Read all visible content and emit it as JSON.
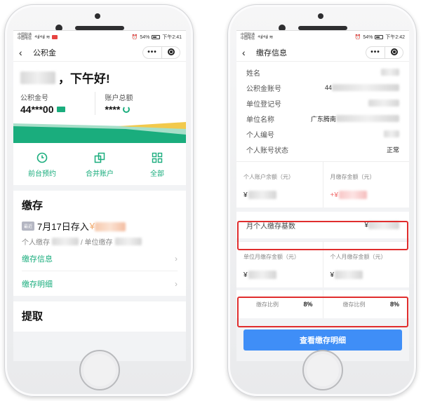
{
  "status_left": {
    "carrier_1": "中国联通",
    "carrier_2": "中国电信",
    "signal": "⁴⁶.ıl ⁴⁶.ıl",
    "battery": "54%",
    "time": "下午2:41"
  },
  "status_right": {
    "carrier_1": "中国联通",
    "carrier_2": "中国电信",
    "signal": "⁴⁶.ıl ⁴⁶.ıl",
    "battery": "54%",
    "time": "下午2:42"
  },
  "left": {
    "nav_title": "公积金",
    "capsule_more": "•••",
    "greeting_suffix": "，下午好!",
    "account_no_label": "公积金号",
    "account_no_value": "44***00",
    "balance_label": "账户总额",
    "balance_value": "****",
    "quick": [
      {
        "label": "前台预约",
        "icon": "clock-icon"
      },
      {
        "label": "合并账户",
        "icon": "merge-icon"
      },
      {
        "label": "全部",
        "icon": "grid-icon"
      }
    ],
    "deposit": {
      "title": "缴存",
      "tag": "最近",
      "latest": "7月17日存入",
      "currency": "¥",
      "personal_label": "个人缴存",
      "unit_label": "/ 单位缴存",
      "links": [
        "缴存信息",
        "缴存明细"
      ]
    },
    "withdraw": {
      "title": "提取"
    }
  },
  "right": {
    "nav_title": "缴存信息",
    "capsule_more": "•••",
    "info_rows": [
      {
        "label": "姓名",
        "value": ""
      },
      {
        "label": "公积金账号",
        "value": "44"
      },
      {
        "label": "单位登记号",
        "value": ""
      },
      {
        "label": "单位名称",
        "value": "广东腾南"
      },
      {
        "label": "个人编号",
        "value": ""
      },
      {
        "label": "个人账号状态",
        "value": "正常"
      }
    ],
    "balance_label": "个人账户余额（元）",
    "balance_currency": "¥",
    "monthly_label": "月缴存金额（元）",
    "monthly_currency": "+¥",
    "base_label": "月个人缴存基数",
    "base_currency": "¥",
    "unit_monthly_label": "单位月缴存金额（元）",
    "unit_monthly_currency": "¥",
    "personal_monthly_label": "个人月缴存金额（元）",
    "personal_monthly_currency": "¥",
    "unit_ratio_label": "缴存比例",
    "unit_ratio_value": "8%",
    "personal_ratio_label": "缴存比例",
    "personal_ratio_value": "8%",
    "button_label": "查看缴存明细"
  },
  "colors": {
    "accent_green": "#1aad7d",
    "button_blue": "#3f8ef7",
    "highlight_red": "#e02d2d",
    "amount_orange": "#f2a96c"
  }
}
